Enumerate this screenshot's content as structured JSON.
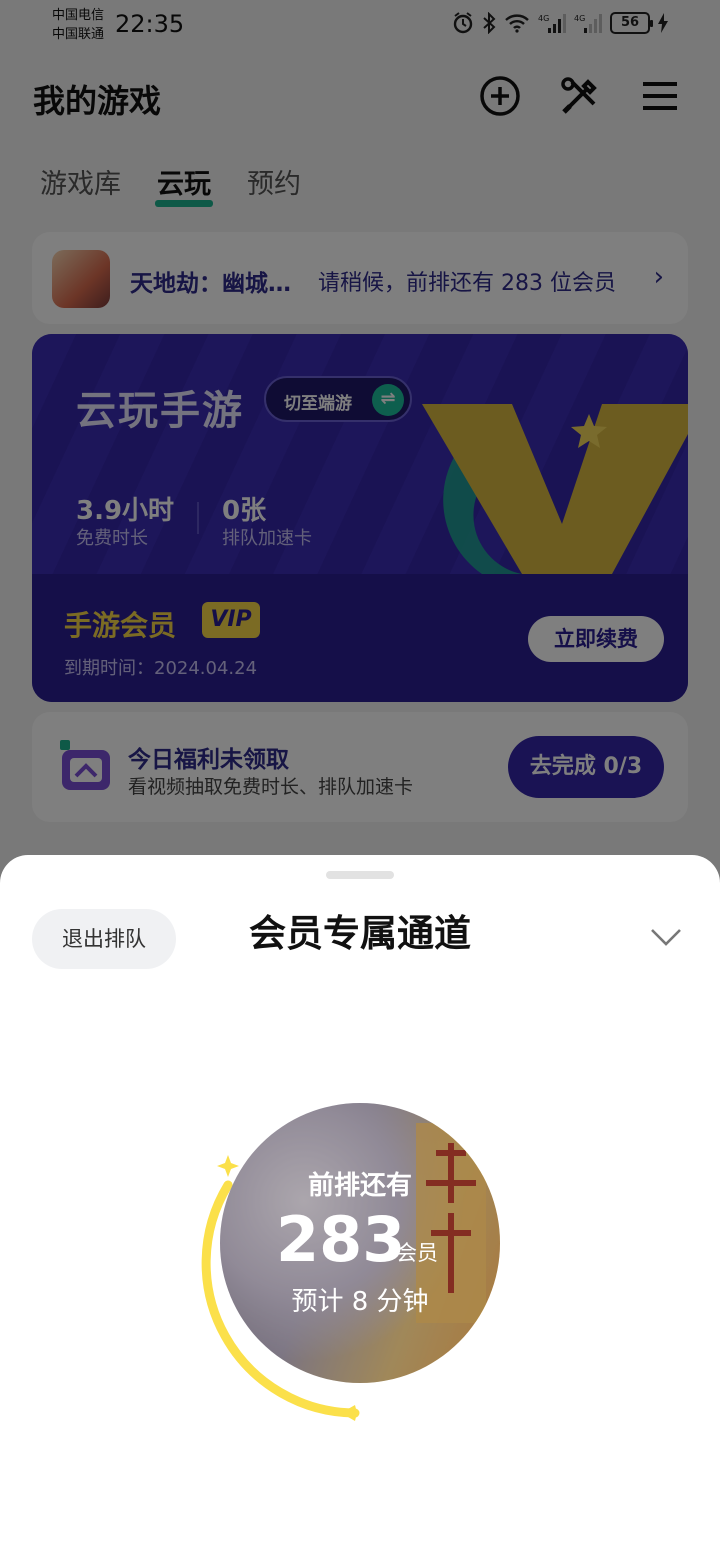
{
  "status_bar": {
    "carrier_1": "中国电信",
    "carrier_2": "中国联通",
    "time": "22:35",
    "battery": "56"
  },
  "header": {
    "title": "我的游戏",
    "icons": [
      "add-circle-icon",
      "tools-icon",
      "menu-icon"
    ]
  },
  "tabs": [
    {
      "label": "游戏库",
      "active": false
    },
    {
      "label": "云玩",
      "active": true
    },
    {
      "label": "预约",
      "active": false
    }
  ],
  "queue_bar": {
    "game": "天地劫：幽城…",
    "message": "请稍候，前排还有 283 位会员"
  },
  "cloud_card": {
    "title": "云玩手游",
    "switch_label": "切至端游",
    "free_time_value": "3.9小时",
    "free_time_label": "免费时长",
    "cards_value": "0张",
    "cards_label": "排队加速卡",
    "member_title": "手游会员",
    "vip": "VIP",
    "expire": "到期时间：2024.04.24",
    "renew": "立即续费"
  },
  "welfare": {
    "title": "今日福利未领取",
    "subtitle": "看视频抽取免费时长、排队加速卡",
    "button": "去完成 0/3"
  },
  "sheet": {
    "exit": "退出排队",
    "title": "会员专属通道",
    "queue_prefix": "前排还有",
    "queue_count": "283",
    "queue_unit": "会员",
    "eta": "预计 8 分钟"
  },
  "colors": {
    "accent_purple": "#3628ad",
    "accent_green": "#1db38f",
    "gold": "#f6d648",
    "ring_yellow": "#fbe04a"
  }
}
